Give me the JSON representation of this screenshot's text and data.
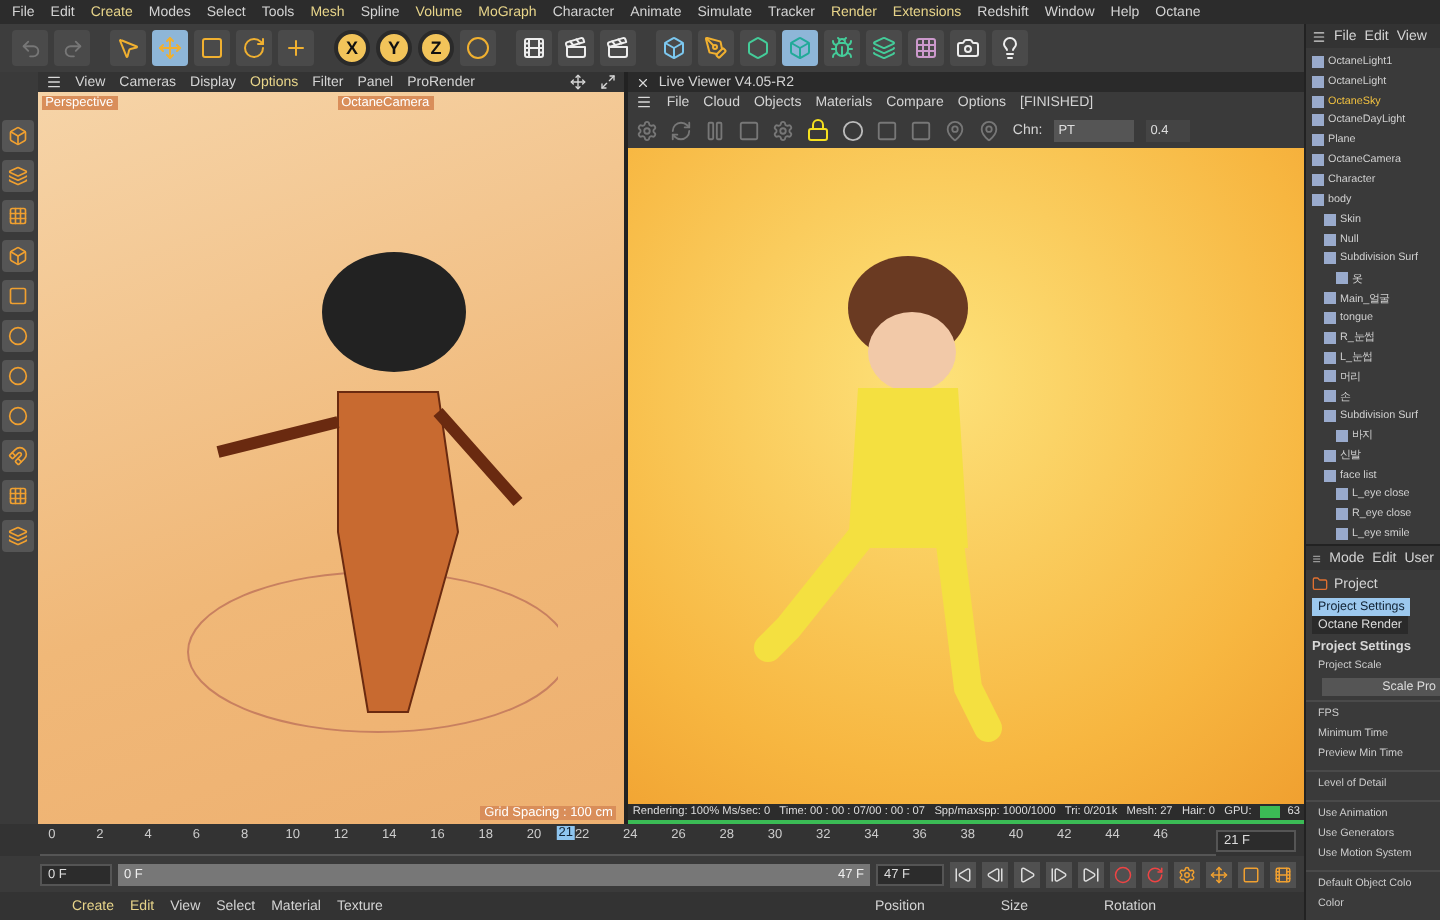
{
  "menu_bar": [
    {
      "label": "File",
      "highlight": false
    },
    {
      "label": "Edit",
      "highlight": false
    },
    {
      "label": "Create",
      "highlight": true
    },
    {
      "label": "Modes",
      "highlight": false
    },
    {
      "label": "Select",
      "highlight": false
    },
    {
      "label": "Tools",
      "highlight": false
    },
    {
      "label": "Mesh",
      "highlight": true
    },
    {
      "label": "Spline",
      "highlight": false
    },
    {
      "label": "Volume",
      "highlight": true
    },
    {
      "label": "MoGraph",
      "highlight": true
    },
    {
      "label": "Character",
      "highlight": false
    },
    {
      "label": "Animate",
      "highlight": false
    },
    {
      "label": "Simulate",
      "highlight": false
    },
    {
      "label": "Tracker",
      "highlight": false
    },
    {
      "label": "Render",
      "highlight": true
    },
    {
      "label": "Extensions",
      "highlight": true
    },
    {
      "label": "Redshift",
      "highlight": false
    },
    {
      "label": "Window",
      "highlight": false
    },
    {
      "label": "Help",
      "highlight": false
    },
    {
      "label": "Octane",
      "highlight": false
    }
  ],
  "toolbar": {
    "axis_buttons": [
      "X",
      "Y",
      "Z"
    ]
  },
  "viewport": {
    "menu": [
      {
        "label": "View",
        "highlight": false
      },
      {
        "label": "Cameras",
        "highlight": false
      },
      {
        "label": "Display",
        "highlight": false
      },
      {
        "label": "Options",
        "highlight": true
      },
      {
        "label": "Filter",
        "highlight": false
      },
      {
        "label": "Panel",
        "highlight": false
      },
      {
        "label": "ProRender",
        "highlight": false
      }
    ],
    "view_label": "Perspective",
    "camera_label": "OctaneCamera",
    "grid_spacing": "Grid Spacing : 100 cm"
  },
  "live_viewer": {
    "title": "Live Viewer V4.05-R2",
    "menu": [
      "File",
      "Cloud",
      "Objects",
      "Materials",
      "Compare",
      "Options"
    ],
    "status_tag": "[FINISHED]",
    "channel_label": "Chn:",
    "channel": "PT",
    "channel_value": "0.4",
    "status": "Rendering: 100% Ms/sec: 0   Time: 00 : 00 : 07/00 : 00 : 07   Spp/maxspp: 1000/1000   Tri: 0/201k   Mesh: 27   Hair: 0   GPU:",
    "gpu_temp": "63"
  },
  "object_manager": {
    "menu": [
      "File",
      "Edit",
      "View"
    ],
    "items": [
      {
        "label": "OctaneLight1",
        "selected": false
      },
      {
        "label": "OctaneLight",
        "selected": false
      },
      {
        "label": "OctaneSky",
        "selected": true
      },
      {
        "label": "OctaneDayLight",
        "selected": false
      },
      {
        "label": "Plane",
        "selected": false
      },
      {
        "label": "OctaneCamera",
        "selected": false
      },
      {
        "label": "Character",
        "selected": false
      },
      {
        "label": "body",
        "selected": false,
        "children": [
          {
            "label": "Skin",
            "selected": false
          },
          {
            "label": "Null",
            "selected": false
          },
          {
            "label": "Subdivision Surf",
            "selected": false,
            "children": [
              {
                "label": "옷",
                "selected": false
              }
            ]
          },
          {
            "label": "Main_얼굴",
            "selected": false
          },
          {
            "label": "tongue",
            "selected": false
          },
          {
            "label": "R_눈썹",
            "selected": false
          },
          {
            "label": "L_눈썹",
            "selected": false
          },
          {
            "label": "머리",
            "selected": false
          },
          {
            "label": "손",
            "selected": false
          },
          {
            "label": "Subdivision Surf",
            "selected": false,
            "children": [
              {
                "label": "바지",
                "selected": false
              }
            ]
          },
          {
            "label": "신발",
            "selected": false
          },
          {
            "label": "face list",
            "selected": false,
            "children": [
              {
                "label": "L_eye close",
                "selected": false
              },
              {
                "label": "R_eye close",
                "selected": false
              },
              {
                "label": "L_eye smile",
                "selected": false
              }
            ]
          }
        ]
      }
    ]
  },
  "attributes": {
    "menu": [
      "Mode",
      "Edit",
      "User"
    ],
    "object": "Project",
    "tabs": [
      {
        "label": "Project Settings",
        "selected": true
      },
      {
        "label": "Octane Render",
        "selected": false
      }
    ],
    "heading": "Project Settings",
    "fields": [
      {
        "kind": "field",
        "label": "Project Scale"
      },
      {
        "kind": "button",
        "label": "Scale Pro"
      },
      {
        "kind": "gap"
      },
      {
        "kind": "field",
        "label": "FPS"
      },
      {
        "kind": "field",
        "label": "Minimum Time"
      },
      {
        "kind": "field",
        "label": "Preview Min Time"
      },
      {
        "kind": "gap"
      },
      {
        "kind": "field",
        "label": "Level of Detail"
      },
      {
        "kind": "gap"
      },
      {
        "kind": "field",
        "label": "Use Animation"
      },
      {
        "kind": "field",
        "label": "Use Generators"
      },
      {
        "kind": "field",
        "label": "Use Motion System"
      },
      {
        "kind": "gap"
      },
      {
        "kind": "field",
        "label": "Default Object Colo"
      },
      {
        "kind": "field",
        "label": "Color"
      }
    ]
  },
  "timeline": {
    "ticks": [
      "0",
      "2",
      "4",
      "6",
      "8",
      "10",
      "12",
      "14",
      "16",
      "18",
      "20",
      "22",
      "24",
      "26",
      "28",
      "30",
      "32",
      "34",
      "36",
      "38",
      "40",
      "42",
      "44",
      "46"
    ],
    "playhead": {
      "label": "21",
      "level": 0.447
    },
    "frame_field": "21 F",
    "start": "0 F",
    "range": {
      "start": "0 F",
      "end": "47 F",
      "level": 1
    },
    "end": "47 F"
  },
  "material_bar": {
    "menu": [
      {
        "label": "Create",
        "highlight": true
      },
      {
        "label": "Edit",
        "highlight": true
      },
      {
        "label": "View",
        "highlight": false
      },
      {
        "label": "Select",
        "highlight": false
      },
      {
        "label": "Material",
        "highlight": false
      },
      {
        "label": "Texture",
        "highlight": false
      }
    ],
    "coords": [
      "Position",
      "Size",
      "Rotation"
    ]
  }
}
